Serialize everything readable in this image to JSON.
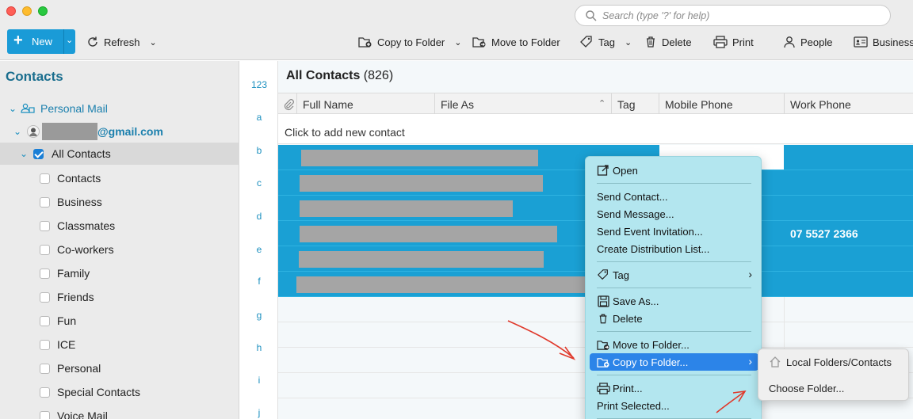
{
  "toolbar": {
    "new_label": "New",
    "refresh_label": "Refresh",
    "copy_to_folder_label": "Copy to Folder",
    "move_to_folder_label": "Move to Folder",
    "tag_label": "Tag",
    "delete_label": "Delete",
    "print_label": "Print",
    "people_label": "People",
    "business_label": "Business"
  },
  "search": {
    "placeholder": "Search (type '?' for help)"
  },
  "sidebar": {
    "title": "Contacts",
    "account_group": "Personal Mail",
    "account_email_suffix": "@gmail.com",
    "all_contacts": "All Contacts",
    "items": [
      {
        "label": "Contacts"
      },
      {
        "label": "Business"
      },
      {
        "label": "Classmates"
      },
      {
        "label": "Co-workers"
      },
      {
        "label": "Family"
      },
      {
        "label": "Friends"
      },
      {
        "label": "Fun"
      },
      {
        "label": "ICE"
      },
      {
        "label": "Personal"
      },
      {
        "label": "Special Contacts"
      },
      {
        "label": "Voice Mail"
      }
    ]
  },
  "alpha_index": [
    "123",
    "a",
    "b",
    "c",
    "d",
    "e",
    "f",
    "g",
    "h",
    "i",
    "j"
  ],
  "main": {
    "title": "All Contacts",
    "count": "(826)",
    "columns": [
      "Full Name",
      "File As",
      "Tag",
      "Mobile Phone",
      "Work Phone"
    ],
    "add_contact": "Click to add new contact",
    "visible_work_phone": "07 5527 2366"
  },
  "context_menu": {
    "open": "Open",
    "send_contact": "Send Contact...",
    "send_message": "Send Message...",
    "send_event_invitation": "Send Event Invitation...",
    "create_distribution_list": "Create Distribution List...",
    "tag": "Tag",
    "save_as": "Save As...",
    "delete": "Delete",
    "move_to_folder": "Move to Folder...",
    "copy_to_folder": "Copy to Folder...",
    "print": "Print...",
    "print_selected": "Print Selected..."
  },
  "submenu": {
    "local_folders": "Local Folders/Contacts",
    "choose_folder": "Choose Folder..."
  },
  "colors": {
    "accent": "#1a9bd7",
    "selection_row": "#1aa0d4",
    "menu_highlight": "#2c84e8",
    "annotation": "#e0392b"
  }
}
